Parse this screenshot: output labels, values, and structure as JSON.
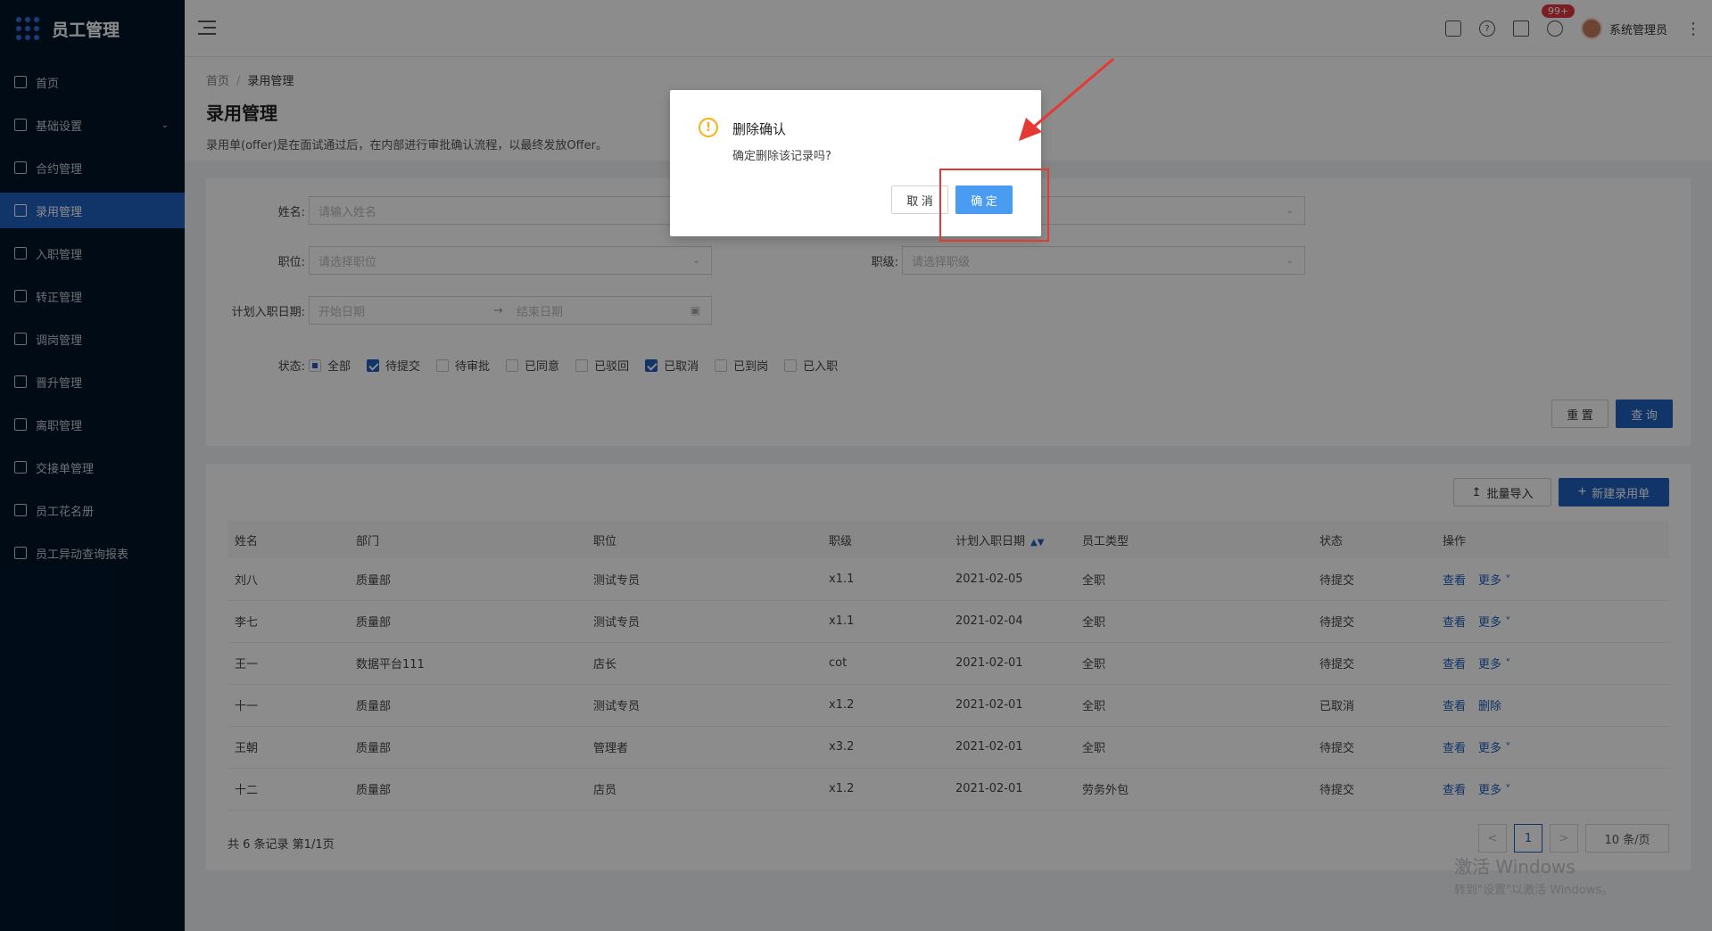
{
  "app": {
    "title": "员工管理"
  },
  "sidebar": {
    "items": [
      {
        "label": "首页",
        "icon": "home-icon"
      },
      {
        "label": "基础设置",
        "icon": "mail-icon",
        "has_submenu": true
      },
      {
        "label": "合约管理",
        "icon": "calendar-icon"
      },
      {
        "label": "录用管理",
        "icon": "layout-icon",
        "active": true
      },
      {
        "label": "入职管理",
        "icon": "book-icon"
      },
      {
        "label": "转正管理",
        "icon": "swap-icon"
      },
      {
        "label": "调岗管理",
        "icon": "user-icon"
      },
      {
        "label": "晋升管理",
        "icon": "doc-icon"
      },
      {
        "label": "离职管理",
        "icon": "leave-icon"
      },
      {
        "label": "交接单管理",
        "icon": "copy-icon"
      },
      {
        "label": "员工花名册",
        "icon": "roster-icon"
      },
      {
        "label": "员工异动查询报表",
        "icon": "report-icon"
      }
    ]
  },
  "header": {
    "notification_badge": "99+",
    "user_name": "系统管理员",
    "help_icon_text": "?"
  },
  "page": {
    "breadcrumb": [
      "首页",
      "录用管理"
    ],
    "breadcrumb_sep": "/",
    "title": "录用管理",
    "description": "录用单(offer)是在面试通过后，在内部进行审批确认流程，以最终发放Offer。"
  },
  "filters": {
    "name_label": "姓名:",
    "name_placeholder": "请输入姓名",
    "position_label": "职位:",
    "position_placeholder": "请选择职位",
    "level_label": "职级:",
    "level_placeholder": "请选择职级",
    "date_label": "计划入职日期:",
    "date_start_placeholder": "开始日期",
    "date_arrow": "→",
    "date_end_placeholder": "结束日期",
    "status_label": "状态:",
    "statuses": [
      {
        "label": "全部",
        "state": "indeterminate"
      },
      {
        "label": "待提交",
        "state": "checked"
      },
      {
        "label": "待审批",
        "state": "unchecked"
      },
      {
        "label": "已同意",
        "state": "unchecked"
      },
      {
        "label": "已驳回",
        "state": "unchecked"
      },
      {
        "label": "已取消",
        "state": "checked"
      },
      {
        "label": "已到岗",
        "state": "unchecked"
      },
      {
        "label": "已入职",
        "state": "unchecked"
      }
    ],
    "reset_label": "重 置",
    "search_label": "查 询"
  },
  "toolbar": {
    "import_label": "批量导入",
    "import_icon": "upload-icon",
    "new_label": "新建录用单",
    "new_icon": "plus-icon"
  },
  "table": {
    "columns": [
      "姓名",
      "部门",
      "职位",
      "职级",
      "计划入职日期",
      "员工类型",
      "状态",
      "操作"
    ],
    "sort_icon": "▲▼",
    "view_label": "查看",
    "rows": [
      {
        "name": "刘八",
        "dept": "质量部",
        "position": "测试专员",
        "level": "x1.1",
        "date": "2021-02-05",
        "type": "全职",
        "status": "待提交",
        "action2": "更多 ˅"
      },
      {
        "name": "李七",
        "dept": "质量部",
        "position": "测试专员",
        "level": "x1.1",
        "date": "2021-02-04",
        "type": "全职",
        "status": "待提交",
        "action2": "更多 ˅"
      },
      {
        "name": "王一",
        "dept": "数据平台111",
        "position": "店长",
        "level": "cot",
        "date": "2021-02-01",
        "type": "全职",
        "status": "待提交",
        "action2": "更多 ˅"
      },
      {
        "name": "十一",
        "dept": "质量部",
        "position": "测试专员",
        "level": "x1.2",
        "date": "2021-02-01",
        "type": "全职",
        "status": "已取消",
        "action2": "删除"
      },
      {
        "name": "王朝",
        "dept": "质量部",
        "position": "管理者",
        "level": "x3.2",
        "date": "2021-02-01",
        "type": "全职",
        "status": "待提交",
        "action2": "更多 ˅"
      },
      {
        "name": "十二",
        "dept": "质量部",
        "position": "店员",
        "level": "x1.2",
        "date": "2021-02-01",
        "type": "劳务外包",
        "status": "待提交",
        "action2": "更多 ˅"
      }
    ]
  },
  "pagination": {
    "total_text": "共 6 条记录 第1/1页",
    "prev": "<",
    "current": "1",
    "next": ">",
    "page_size": "10 条/页"
  },
  "watermark": {
    "line1": "激活 Windows",
    "line2": "转到\"设置\"以激活 Windows。"
  },
  "modal": {
    "title": "删除确认",
    "content": "确定删除该记录吗?",
    "icon_text": "!",
    "cancel_label": "取 消",
    "ok_label": "确 定"
  },
  "colors": {
    "primary": "#1f5fbf",
    "sidebar_bg": "#001529",
    "modal_ok": "#4a9cf2",
    "warning": "#faad14",
    "annotation": "#e53935"
  }
}
